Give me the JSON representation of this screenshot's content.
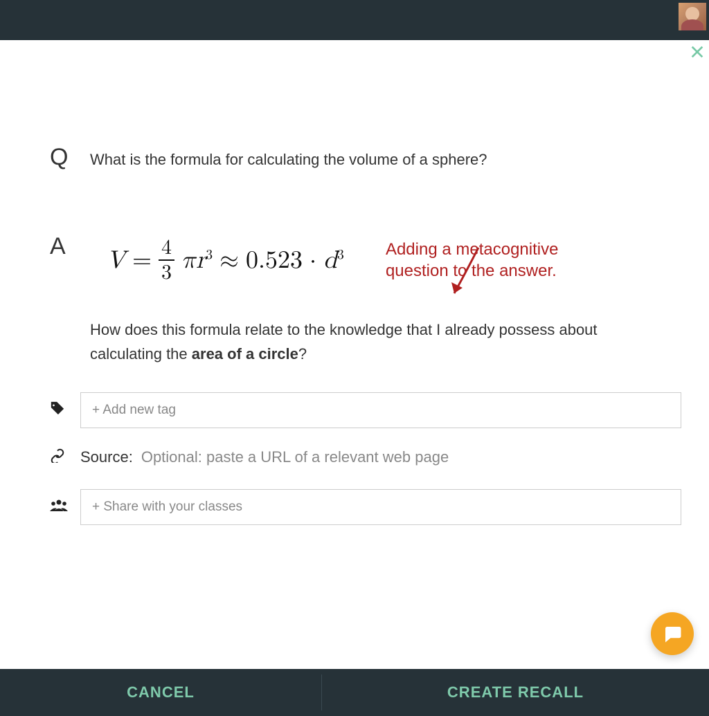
{
  "header": {
    "avatar_name": "user-avatar"
  },
  "close_label": "✕",
  "question": {
    "letter": "Q",
    "text": "What is the formula for calculating the volume of a sphere?"
  },
  "answer": {
    "letter": "A",
    "formula_plain": "V = 4/3 π r³ ≈ 0.523 · d³",
    "followup_pre": "How does this formula relate to the knowledge that I already possess about calculating the ",
    "followup_bold": "area of a circle",
    "followup_post": "?"
  },
  "annotation": {
    "text": "Adding a metacognitive question to the answer."
  },
  "tags": {
    "placeholder": "+ Add new tag"
  },
  "source": {
    "label": "Source:",
    "placeholder": "Optional: paste a URL of a relevant web page"
  },
  "share": {
    "placeholder": "+ Share with your classes"
  },
  "buttons": {
    "cancel": "CANCEL",
    "create": "CREATE RECALL"
  }
}
